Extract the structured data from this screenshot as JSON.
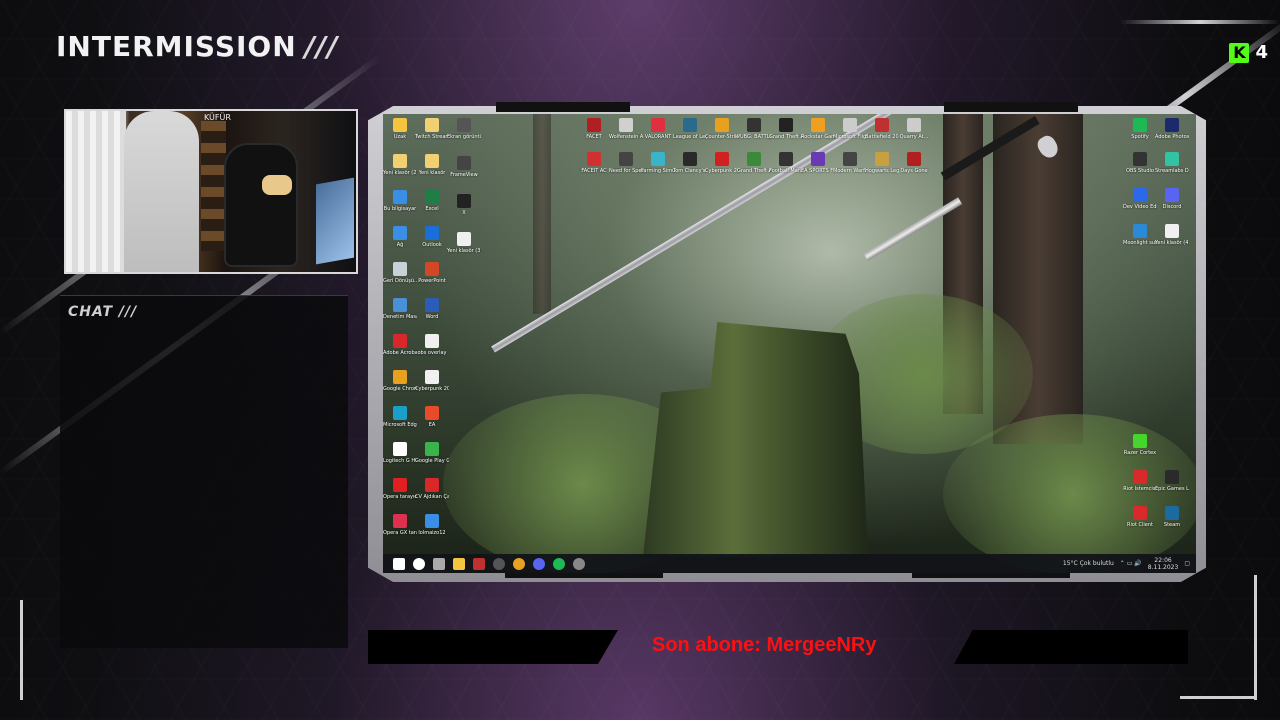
{
  "overlay": {
    "title": "INTERMISSION",
    "title_marks": "///",
    "chat_title": "CHAT ///",
    "kick_icon_letter": "K",
    "kick_viewers": "4",
    "last_subscriber": "Son abone: MergeeNRy",
    "webcam_label": "KÜFÜR"
  },
  "desktop": {
    "left_column_icons": [
      {
        "label": "Uzak",
        "color": "#f5c542",
        "icon": "folder-icon"
      },
      {
        "label": "Yeni klasör (2)",
        "color": "#f0d070",
        "icon": "folder-icon"
      },
      {
        "label": "Bu bilgisayar",
        "color": "#3a8ee6",
        "icon": "computer-icon"
      },
      {
        "label": "Ağ",
        "color": "#3a8ee6",
        "icon": "network-icon"
      },
      {
        "label": "Geri Dönüşü...",
        "color": "#c8d0d8",
        "icon": "recycle-bin-icon"
      },
      {
        "label": "Denetim Masası",
        "color": "#4a90d9",
        "icon": "control-panel-icon"
      },
      {
        "label": "Adobe Acrobat",
        "color": "#d8282a",
        "icon": "acrobat-icon"
      },
      {
        "label": "Google Chrome",
        "color": "#e8a020",
        "icon": "chrome-icon"
      },
      {
        "label": "Microsoft Edge",
        "color": "#1aa0c8",
        "icon": "edge-icon"
      },
      {
        "label": "Logitech G HUB",
        "color": "#ffffff",
        "icon": "logitech-icon"
      },
      {
        "label": "Opera tarayıcı",
        "color": "#e02020",
        "icon": "opera-icon"
      },
      {
        "label": "Opera GX tarayıcı",
        "color": "#e03050",
        "icon": "opera-gx-icon"
      }
    ],
    "second_column_icons": [
      {
        "label": "Twitch Streamer",
        "color": "#f0d070",
        "icon": "folder-icon"
      },
      {
        "label": "Yeni klasör",
        "color": "#f0d070",
        "icon": "folder-icon"
      },
      {
        "label": "Excel",
        "color": "#1e7e45",
        "icon": "excel-icon"
      },
      {
        "label": "Outlook",
        "color": "#1a6ed8",
        "icon": "outlook-icon"
      },
      {
        "label": "PowerPoint",
        "color": "#d24726",
        "icon": "powerpoint-icon"
      },
      {
        "label": "Word",
        "color": "#2b5cb8",
        "icon": "word-icon"
      },
      {
        "label": "obs overlay",
        "color": "#f0f0f0",
        "icon": "file-icon"
      },
      {
        "label": "Cyberpunk 2077 Bon...",
        "color": "#f0f0f0",
        "icon": "file-icon"
      },
      {
        "label": "EA",
        "color": "#e84a2a",
        "icon": "ea-icon"
      },
      {
        "label": "Google Play Games Beta",
        "color": "#3ab44a",
        "icon": "google-play-icon"
      },
      {
        "label": "CV Ajdıkan Çalışı Yil...",
        "color": "#d8282a",
        "icon": "pdf-icon"
      },
      {
        "label": "lolmaizo12",
        "color": "#3a8ee6",
        "icon": "file-icon"
      }
    ],
    "third_column_icons": [
      {
        "label": "Ekran görüntüsü...",
        "color": "#555555",
        "icon": "image-icon"
      },
      {
        "label": "FrameView",
        "color": "#444444",
        "icon": "frameview-icon"
      },
      {
        "label": "X",
        "color": "#222222",
        "icon": "x-icon"
      },
      {
        "label": "Yeni klasör (3)",
        "color": "#f0f0f0",
        "icon": "file-icon"
      }
    ],
    "top_row_icons": [
      {
        "label": "FACET",
        "color": "#b02020"
      },
      {
        "label": "Wolfenstein Arena",
        "color": "#d0d0d0"
      },
      {
        "label": "VALORANT",
        "color": "#e03040"
      },
      {
        "label": "League of Legends",
        "color": "#2a6a8a"
      },
      {
        "label": "Counter-Strike 2",
        "color": "#e8a020"
      },
      {
        "label": "PUBG: BATTLEGR...",
        "color": "#333333"
      },
      {
        "label": "Grand Theft Auto V",
        "color": "#222222"
      },
      {
        "label": "Rockstar Games...",
        "color": "#f0a020"
      },
      {
        "label": "Microsoft Flight Simulator",
        "color": "#cccccc"
      },
      {
        "label": "Battlefield 2042",
        "color": "#c03030"
      },
      {
        "label": "Quarry At...",
        "color": "#cccccc"
      }
    ],
    "second_row_icons": [
      {
        "label": "FACEIT AC",
        "color": "#d03030"
      },
      {
        "label": "Need for Speed Unbound",
        "color": "#444444"
      },
      {
        "label": "Farming Simulator 22",
        "color": "#3ab4c8"
      },
      {
        "label": "Tom Clancy's Rainbow Six",
        "color": "#2a2a2a"
      },
      {
        "label": "Cyberpunk 2077",
        "color": "#d02020"
      },
      {
        "label": "Grand Theft Auto V",
        "color": "#3a8a3a"
      },
      {
        "label": "Football Manager",
        "color": "#333333"
      },
      {
        "label": "EA SPORTS FC 24",
        "color": "#6a3ab4"
      },
      {
        "label": "Modern Warfare II",
        "color": "#444444"
      },
      {
        "label": "Hogwarts Legacy",
        "color": "#c8a040"
      },
      {
        "label": "Days Gone",
        "color": "#b02020"
      }
    ],
    "right_column_icons": [
      {
        "label": "Spotify",
        "color": "#1db954"
      },
      {
        "label": "Adobe Photosh...",
        "color": "#1a2a6a"
      },
      {
        "label": "OBS Studio",
        "color": "#333333"
      },
      {
        "label": "Streamlabs Desktop",
        "color": "#31c3a2"
      },
      {
        "label": "Dev Video Editor 26",
        "color": "#2a6ae8"
      },
      {
        "label": "Discord",
        "color": "#5865f2"
      },
      {
        "label": "Moonlight suite",
        "color": "#2a8ad8"
      },
      {
        "label": "Yeni klasör (4)",
        "color": "#f0f0f0"
      },
      {
        "label": "Razer Cortex",
        "color": "#44d62c"
      },
      {
        "label": "Riot İstemcisi",
        "color": "#d82a2a"
      },
      {
        "label": "Epic Games Launcher",
        "color": "#2a2a2a"
      },
      {
        "label": "Riot Client",
        "color": "#d82a2a"
      },
      {
        "label": "Steam",
        "color": "#1b6aa0"
      }
    ],
    "taskbar": {
      "items": [
        {
          "icon": "windows-start-icon",
          "color": "#ffffff"
        },
        {
          "icon": "search-icon",
          "color": "#ffffff"
        },
        {
          "icon": "task-view-icon",
          "color": "#aaaaaa"
        },
        {
          "icon": "file-explorer-icon",
          "color": "#f5c542"
        },
        {
          "icon": "obs-icon",
          "color": "#c03030"
        },
        {
          "icon": "steam-icon",
          "color": "#555555"
        },
        {
          "icon": "chrome-icon",
          "color": "#e8a020"
        },
        {
          "icon": "discord-icon",
          "color": "#5865f2"
        },
        {
          "icon": "spotify-icon",
          "color": "#1db954"
        },
        {
          "icon": "obs-studio-icon",
          "color": "#888888"
        }
      ],
      "weather": "15°C  Çok bulutlu",
      "time": "22:06",
      "date": "8.11.2023"
    }
  }
}
